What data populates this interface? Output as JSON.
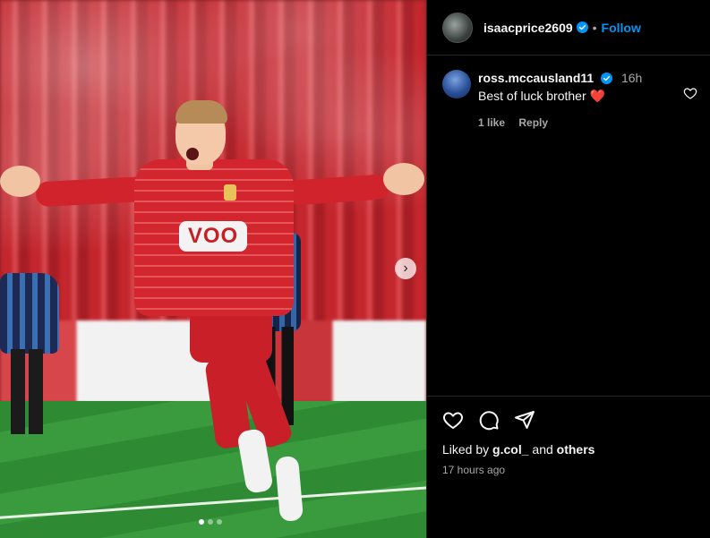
{
  "post": {
    "username": "isaacprice2609",
    "separator": "•",
    "follow_label": "Follow",
    "media": {
      "slide_count": 3,
      "active_slide": 1,
      "next_icon": "chevron-right-icon",
      "sponsor_text": "VOO"
    }
  },
  "comment": {
    "username": "ross.mccausland11",
    "time": "16h",
    "text": "Best of luck brother ❤️",
    "likes_label": "1 like",
    "reply_label": "Reply"
  },
  "footer": {
    "liked_by_prefix": "Liked by ",
    "liked_by_user": "g.col_",
    "liked_by_mid": " and ",
    "liked_by_others": "others",
    "time_ago": "17 hours ago"
  },
  "icons": [
    "heart-icon",
    "comment-icon",
    "share-icon",
    "verified-badge-icon"
  ],
  "colors": {
    "accent": "#0095f6",
    "background": "#000000",
    "secondary_text": "#a8a8a8"
  }
}
